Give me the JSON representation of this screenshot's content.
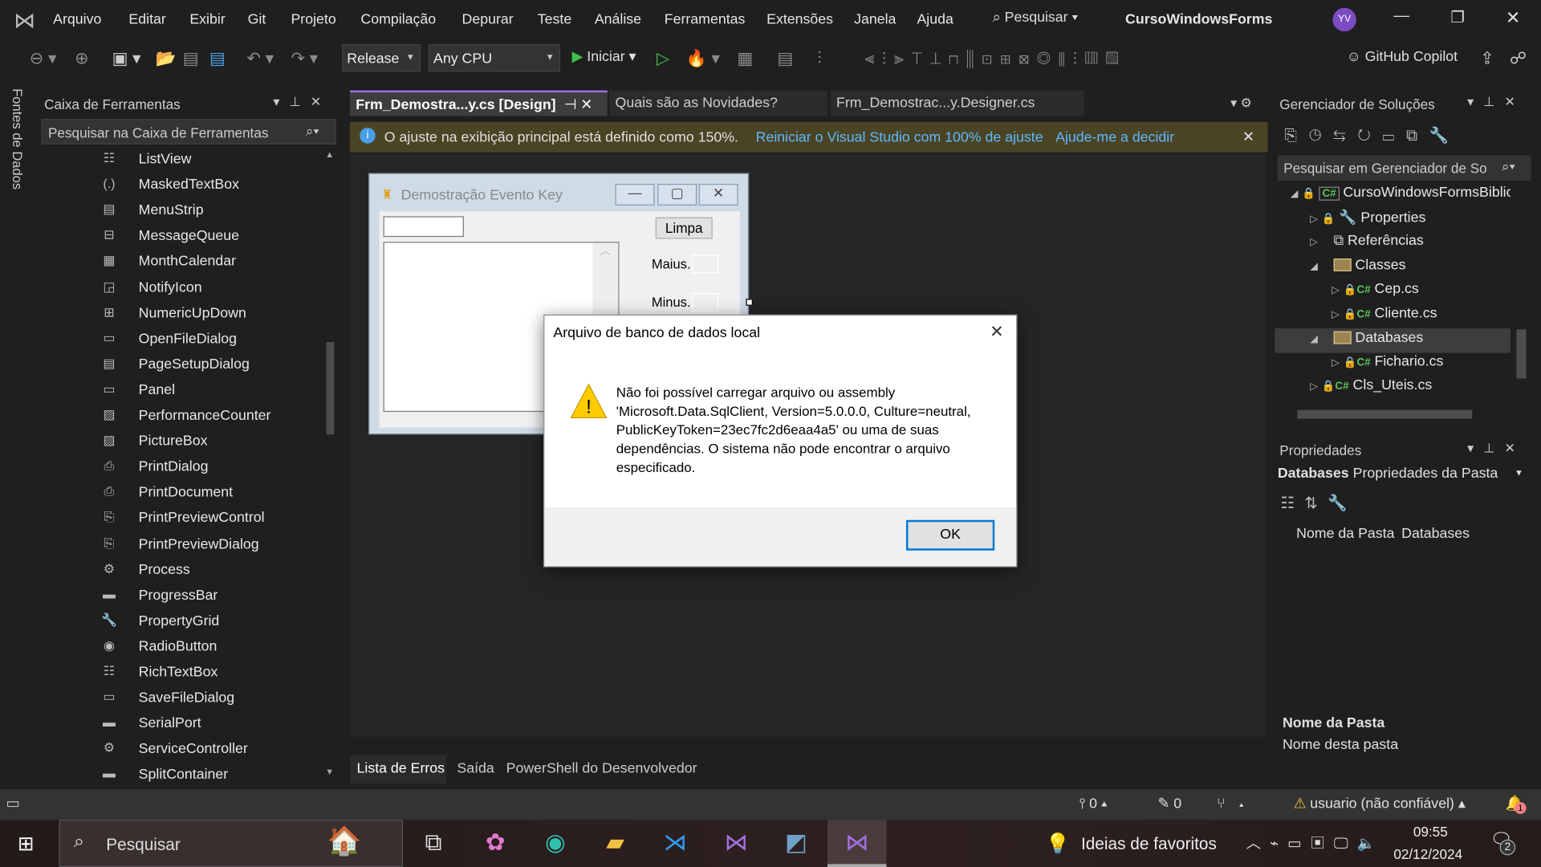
{
  "menubar": {
    "items": [
      "Arquivo",
      "Editar",
      "Exibir",
      "Git",
      "Projeto",
      "Compilação",
      "Depurar",
      "Teste",
      "Análise",
      "Ferramentas",
      "Extensões",
      "Janela",
      "Ajuda"
    ],
    "search": "Pesquisar",
    "solution_name": "CursoWindowsForms",
    "avatar": "YV"
  },
  "toolbar": {
    "configuration": "Release",
    "platform": "Any CPU",
    "start": "Iniciar",
    "copilot": "GitHub Copilot"
  },
  "side_strip": {
    "label": "Fontes de Dados"
  },
  "toolbox": {
    "title": "Caixa de Ferramentas",
    "search_placeholder": "Pesquisar na Caixa de Ferramentas",
    "items": [
      "ListView",
      "MaskedTextBox",
      "MenuStrip",
      "MessageQueue",
      "MonthCalendar",
      "NotifyIcon",
      "NumericUpDown",
      "OpenFileDialog",
      "PageSetupDialog",
      "Panel",
      "PerformanceCounter",
      "PictureBox",
      "PrintDialog",
      "PrintDocument",
      "PrintPreviewControl",
      "PrintPreviewDialog",
      "Process",
      "ProgressBar",
      "PropertyGrid",
      "RadioButton",
      "RichTextBox",
      "SaveFileDialog",
      "SerialPort",
      "ServiceController",
      "SplitContainer"
    ]
  },
  "tabs": [
    {
      "label": "Frm_Demostra...y.cs [Design]",
      "active": true
    },
    {
      "label": "Quais são as Novidades?"
    },
    {
      "label": "Frm_Demostrac...y.Designer.cs"
    }
  ],
  "infobar": {
    "message": "O ajuste na exibição principal está definido como 150%.",
    "link1": "Reiniciar o Visual Studio com 100% de ajuste",
    "link2": "Ajude-me a decidir"
  },
  "form": {
    "title": "Demostração Evento Key",
    "button": "Limpa",
    "label_upper": "Maius.",
    "label_lower": "Minus."
  },
  "dialog": {
    "title": "Arquivo de banco de dados local",
    "message_lines": [
      "Não foi possível carregar arquivo ou assembly",
      "'Microsoft.Data.SqlClient, Version=5.0.0.0, Culture=neutral,",
      "PublicKeyToken=23ec7fc2d6eaa4a5' ou uma de suas",
      "dependências. O sistema não pode encontrar o arquivo",
      "especificado."
    ],
    "ok": "OK"
  },
  "bottom_tabs": [
    "Lista de Erros",
    "Saída",
    "PowerShell do Desenvolvedor"
  ],
  "solution_explorer": {
    "title": "Gerenciador de Soluções",
    "search_placeholder": "Pesquisar em Gerenciador de So",
    "project": "CursoWindowsFormsBiblio",
    "properties": "Properties",
    "references": "Referências",
    "classes": "Classes",
    "cep": "Cep.cs",
    "cliente": "Cliente.cs",
    "databases": "Databases",
    "fichario": "Fichario.cs",
    "uteis": "Cls_Uteis.cs"
  },
  "properties": {
    "title": "Propriedades",
    "object": "Databases",
    "object_type": "Propriedades da Pasta",
    "prop_name": "Nome da Pasta",
    "prop_value": "Databases",
    "desc_title": "Nome da Pasta",
    "desc_text": "Nome desta pasta"
  },
  "statusbar": {
    "commits": "0",
    "changes": "0",
    "user": "usuario (não confiável)",
    "notifications": "1"
  },
  "taskbar": {
    "search": "Pesquisar",
    "widget": "Ideias de favoritos",
    "time": "09:55",
    "date": "02/12/2024",
    "action_center": "2"
  },
  "colors": {
    "accent": "#9b6ee8",
    "link": "#5fb8ff",
    "infobar": "#4a4424",
    "dialog_button": "#0078d7"
  }
}
